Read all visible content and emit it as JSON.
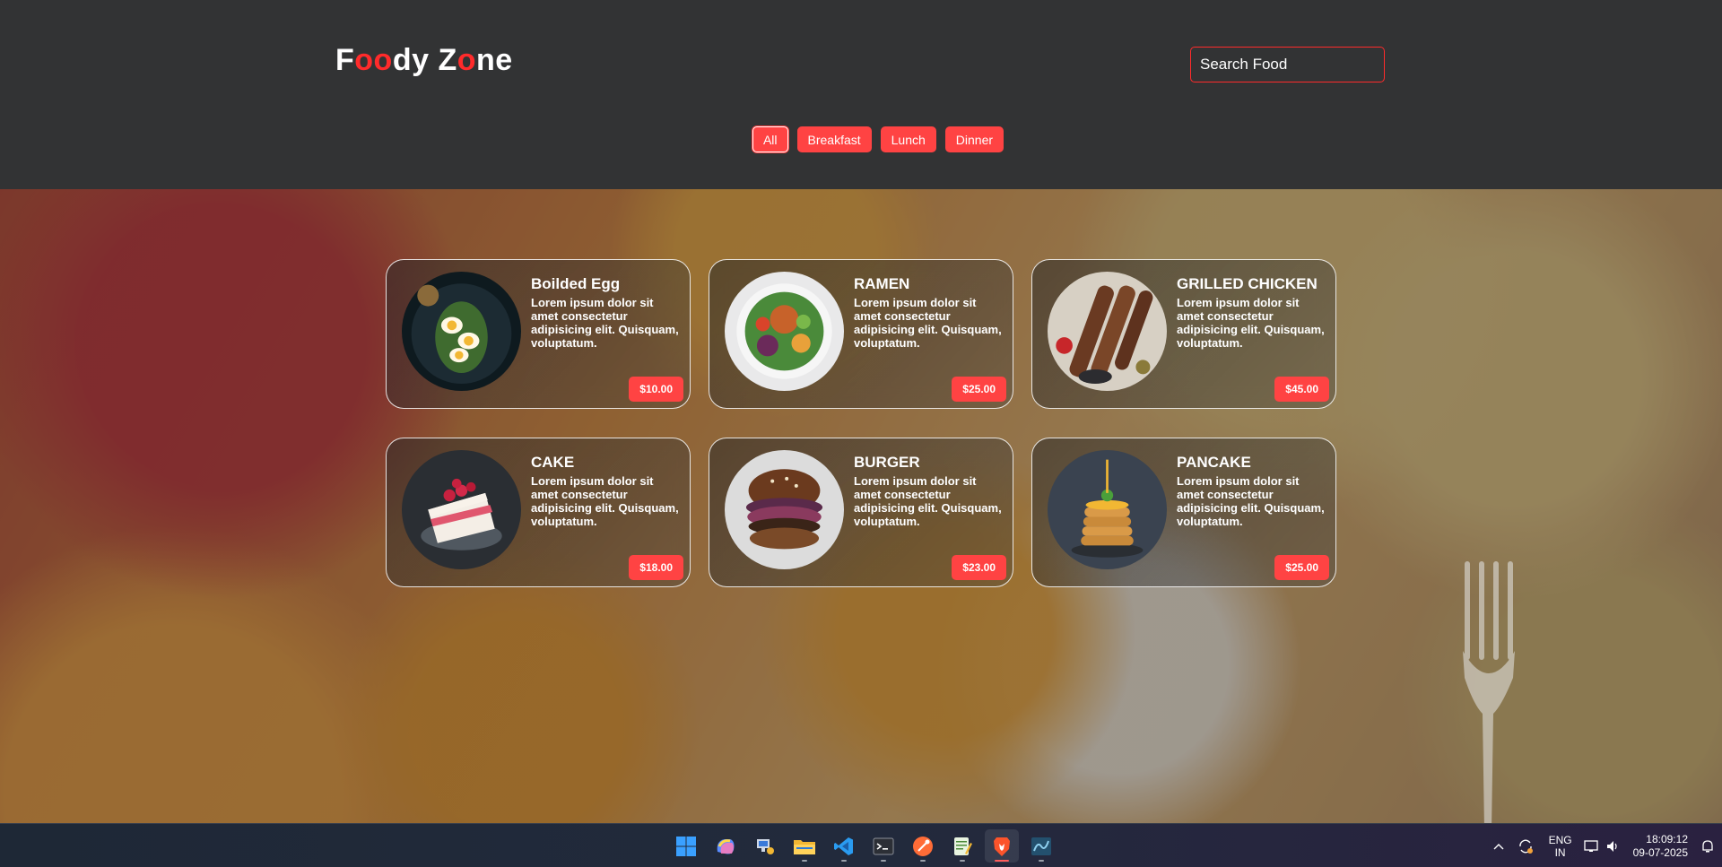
{
  "header": {
    "logo_parts": [
      {
        "text": "F",
        "red": false
      },
      {
        "text": "oo",
        "red": true
      },
      {
        "text": "dy Z",
        "red": false
      },
      {
        "text": "o",
        "red": true
      },
      {
        "text": "ne",
        "red": false
      }
    ],
    "search_placeholder": "Search Food"
  },
  "filters": [
    {
      "label": "All",
      "active": true
    },
    {
      "label": "Breakfast",
      "active": false
    },
    {
      "label": "Lunch",
      "active": false
    },
    {
      "label": "Dinner",
      "active": false
    }
  ],
  "foods": [
    {
      "name": "Boilded Egg",
      "desc": "Lorem ipsum dolor sit amet consectetur adipisicing elit. Quisquam, voluptatum.",
      "price": "$10.00",
      "image": "boiled-egg-image"
    },
    {
      "name": "RAMEN",
      "desc": "Lorem ipsum dolor sit amet consectetur adipisicing elit. Quisquam, voluptatum.",
      "price": "$25.00",
      "image": "ramen-image"
    },
    {
      "name": "GRILLED CHICKEN",
      "desc": "Lorem ipsum dolor sit amet consectetur adipisicing elit. Quisquam, voluptatum.",
      "price": "$45.00",
      "image": "grilled-chicken-image"
    },
    {
      "name": "CAKE",
      "desc": "Lorem ipsum dolor sit amet consectetur adipisicing elit. Quisquam, voluptatum.",
      "price": "$18.00",
      "image": "cake-image"
    },
    {
      "name": "BURGER",
      "desc": "Lorem ipsum dolor sit amet consectetur adipisicing elit. Quisquam, voluptatum.",
      "price": "$23.00",
      "image": "burger-image"
    },
    {
      "name": "PANCAKE",
      "desc": "Lorem ipsum dolor sit amet consectetur adipisicing elit. Quisquam, voluptatum.",
      "price": "$25.00",
      "image": "pancake-image"
    }
  ],
  "colors": {
    "accent": "#ff4343",
    "header_bg": "#323334"
  },
  "taskbar": {
    "apps": [
      "windows-start-icon",
      "copilot-icon",
      "network-tool-icon",
      "file-explorer-icon",
      "vscode-icon",
      "terminal-icon",
      "postman-icon",
      "notepad-icon",
      "brave-browser-icon",
      "mysql-workbench-icon"
    ],
    "active_app": "brave-browser-icon",
    "lang_line1": "ENG",
    "lang_line2": "IN",
    "time": "18:09:12",
    "date": "09-07-2025"
  }
}
